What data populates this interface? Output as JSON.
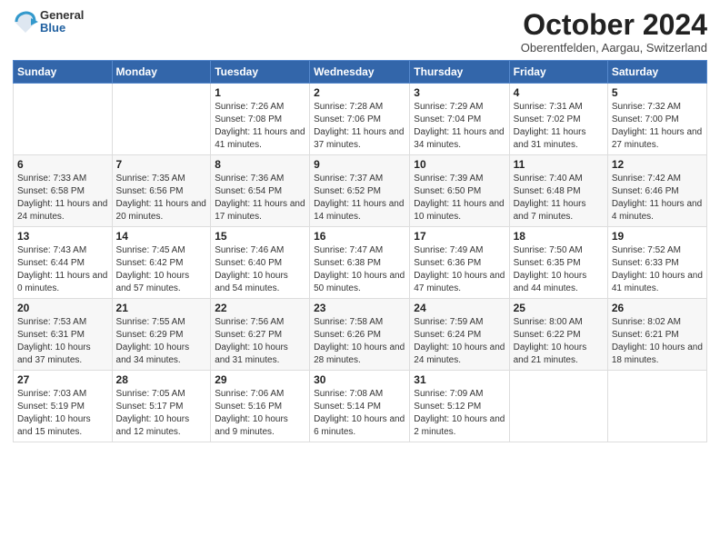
{
  "header": {
    "logo": {
      "general": "General",
      "blue": "Blue"
    },
    "title": "October 2024",
    "location": "Oberentfelden, Aargau, Switzerland"
  },
  "days_of_week": [
    "Sunday",
    "Monday",
    "Tuesday",
    "Wednesday",
    "Thursday",
    "Friday",
    "Saturday"
  ],
  "weeks": [
    [
      {
        "day": "",
        "info": ""
      },
      {
        "day": "",
        "info": ""
      },
      {
        "day": "1",
        "info": "Sunrise: 7:26 AM\nSunset: 7:08 PM\nDaylight: 11 hours and 41 minutes."
      },
      {
        "day": "2",
        "info": "Sunrise: 7:28 AM\nSunset: 7:06 PM\nDaylight: 11 hours and 37 minutes."
      },
      {
        "day": "3",
        "info": "Sunrise: 7:29 AM\nSunset: 7:04 PM\nDaylight: 11 hours and 34 minutes."
      },
      {
        "day": "4",
        "info": "Sunrise: 7:31 AM\nSunset: 7:02 PM\nDaylight: 11 hours and 31 minutes."
      },
      {
        "day": "5",
        "info": "Sunrise: 7:32 AM\nSunset: 7:00 PM\nDaylight: 11 hours and 27 minutes."
      }
    ],
    [
      {
        "day": "6",
        "info": "Sunrise: 7:33 AM\nSunset: 6:58 PM\nDaylight: 11 hours and 24 minutes."
      },
      {
        "day": "7",
        "info": "Sunrise: 7:35 AM\nSunset: 6:56 PM\nDaylight: 11 hours and 20 minutes."
      },
      {
        "day": "8",
        "info": "Sunrise: 7:36 AM\nSunset: 6:54 PM\nDaylight: 11 hours and 17 minutes."
      },
      {
        "day": "9",
        "info": "Sunrise: 7:37 AM\nSunset: 6:52 PM\nDaylight: 11 hours and 14 minutes."
      },
      {
        "day": "10",
        "info": "Sunrise: 7:39 AM\nSunset: 6:50 PM\nDaylight: 11 hours and 10 minutes."
      },
      {
        "day": "11",
        "info": "Sunrise: 7:40 AM\nSunset: 6:48 PM\nDaylight: 11 hours and 7 minutes."
      },
      {
        "day": "12",
        "info": "Sunrise: 7:42 AM\nSunset: 6:46 PM\nDaylight: 11 hours and 4 minutes."
      }
    ],
    [
      {
        "day": "13",
        "info": "Sunrise: 7:43 AM\nSunset: 6:44 PM\nDaylight: 11 hours and 0 minutes."
      },
      {
        "day": "14",
        "info": "Sunrise: 7:45 AM\nSunset: 6:42 PM\nDaylight: 10 hours and 57 minutes."
      },
      {
        "day": "15",
        "info": "Sunrise: 7:46 AM\nSunset: 6:40 PM\nDaylight: 10 hours and 54 minutes."
      },
      {
        "day": "16",
        "info": "Sunrise: 7:47 AM\nSunset: 6:38 PM\nDaylight: 10 hours and 50 minutes."
      },
      {
        "day": "17",
        "info": "Sunrise: 7:49 AM\nSunset: 6:36 PM\nDaylight: 10 hours and 47 minutes."
      },
      {
        "day": "18",
        "info": "Sunrise: 7:50 AM\nSunset: 6:35 PM\nDaylight: 10 hours and 44 minutes."
      },
      {
        "day": "19",
        "info": "Sunrise: 7:52 AM\nSunset: 6:33 PM\nDaylight: 10 hours and 41 minutes."
      }
    ],
    [
      {
        "day": "20",
        "info": "Sunrise: 7:53 AM\nSunset: 6:31 PM\nDaylight: 10 hours and 37 minutes."
      },
      {
        "day": "21",
        "info": "Sunrise: 7:55 AM\nSunset: 6:29 PM\nDaylight: 10 hours and 34 minutes."
      },
      {
        "day": "22",
        "info": "Sunrise: 7:56 AM\nSunset: 6:27 PM\nDaylight: 10 hours and 31 minutes."
      },
      {
        "day": "23",
        "info": "Sunrise: 7:58 AM\nSunset: 6:26 PM\nDaylight: 10 hours and 28 minutes."
      },
      {
        "day": "24",
        "info": "Sunrise: 7:59 AM\nSunset: 6:24 PM\nDaylight: 10 hours and 24 minutes."
      },
      {
        "day": "25",
        "info": "Sunrise: 8:00 AM\nSunset: 6:22 PM\nDaylight: 10 hours and 21 minutes."
      },
      {
        "day": "26",
        "info": "Sunrise: 8:02 AM\nSunset: 6:21 PM\nDaylight: 10 hours and 18 minutes."
      }
    ],
    [
      {
        "day": "27",
        "info": "Sunrise: 7:03 AM\nSunset: 5:19 PM\nDaylight: 10 hours and 15 minutes."
      },
      {
        "day": "28",
        "info": "Sunrise: 7:05 AM\nSunset: 5:17 PM\nDaylight: 10 hours and 12 minutes."
      },
      {
        "day": "29",
        "info": "Sunrise: 7:06 AM\nSunset: 5:16 PM\nDaylight: 10 hours and 9 minutes."
      },
      {
        "day": "30",
        "info": "Sunrise: 7:08 AM\nSunset: 5:14 PM\nDaylight: 10 hours and 6 minutes."
      },
      {
        "day": "31",
        "info": "Sunrise: 7:09 AM\nSunset: 5:12 PM\nDaylight: 10 hours and 2 minutes."
      },
      {
        "day": "",
        "info": ""
      },
      {
        "day": "",
        "info": ""
      }
    ]
  ]
}
